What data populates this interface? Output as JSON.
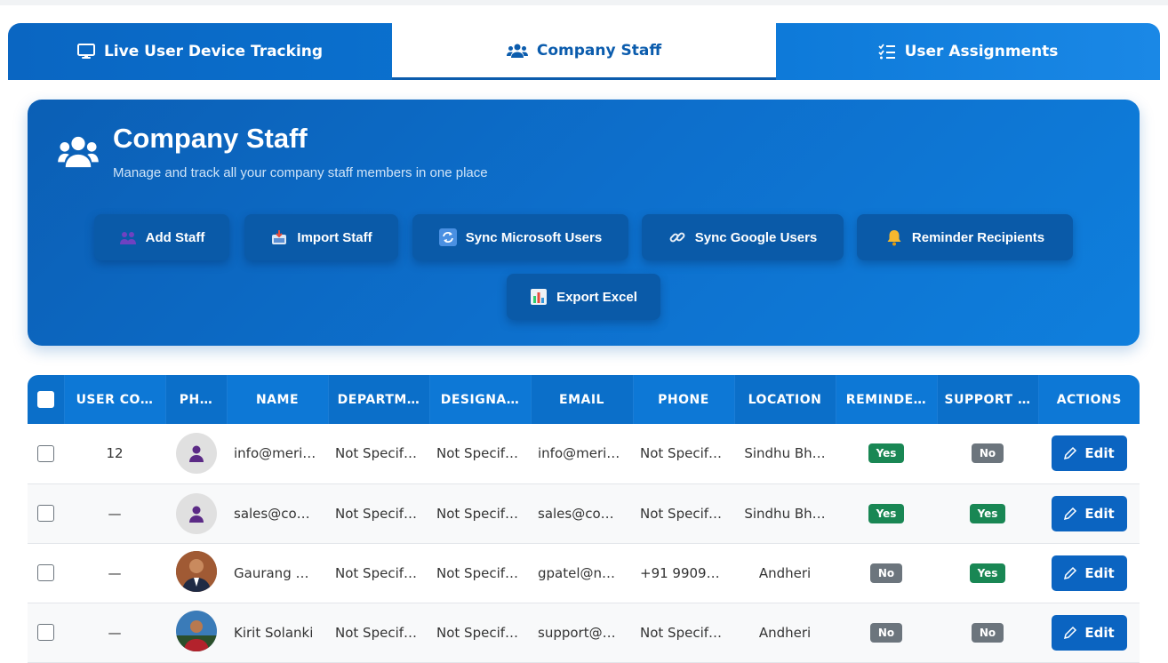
{
  "tabs": [
    {
      "label": "Live User Device Tracking",
      "icon": "monitor-icon"
    },
    {
      "label": "Company Staff",
      "icon": "users-icon"
    },
    {
      "label": "User Assignments",
      "icon": "list-check-icon"
    }
  ],
  "hero": {
    "title": "Company Staff",
    "subtitle": "Manage and track all your company staff members in one place"
  },
  "actions": [
    {
      "label": "Add Staff",
      "icon": "add-people-icon"
    },
    {
      "label": "Import Staff",
      "icon": "inbox-tray-icon"
    },
    {
      "label": "Sync Microsoft Users",
      "icon": "sync-icon"
    },
    {
      "label": "Sync Google Users",
      "icon": "link-icon"
    },
    {
      "label": "Reminder Recipients",
      "icon": "bell-icon"
    },
    {
      "label": "Export Excel",
      "icon": "chart-icon"
    }
  ],
  "table": {
    "headers": [
      "USER CO…",
      "PH…",
      "NAME",
      "DEPARTM…",
      "DESIGNA…",
      "EMAIL",
      "PHONE",
      "LOCATION",
      "REMINDE…",
      "SUPPORT …",
      "ACTIONS"
    ],
    "rows": [
      {
        "code": "12",
        "name": "info@meri…",
        "department": "Not Specif…",
        "designation": "Not Specif…",
        "email": "info@meri…",
        "phone": "Not Specif…",
        "location": "Sindhu Bh…",
        "reminder": "Yes",
        "support": "No",
        "action": "Edit"
      },
      {
        "code": "—",
        "name": "sales@co…",
        "department": "Not Specif…",
        "designation": "Not Specif…",
        "email": "sales@co…",
        "phone": "Not Specif…",
        "location": "Sindhu Bh…",
        "reminder": "Yes",
        "support": "Yes",
        "action": "Edit"
      },
      {
        "code": "—",
        "name": "Gaurang …",
        "department": "Not Specif…",
        "designation": "Not Specif…",
        "email": "gpatel@n…",
        "phone": "+91 99090…",
        "location": "Andheri",
        "reminder": "No",
        "support": "Yes",
        "action": "Edit"
      },
      {
        "code": "—",
        "name": "Kirit Solanki",
        "department": "Not Specif…",
        "designation": "Not Specif…",
        "email": "support@…",
        "phone": "Not Specif…",
        "location": "Andheri",
        "reminder": "No",
        "support": "No",
        "action": "Edit"
      }
    ]
  },
  "colors": {
    "primary": "#0b64c1",
    "yes": "#198754",
    "no": "#6c757d"
  }
}
